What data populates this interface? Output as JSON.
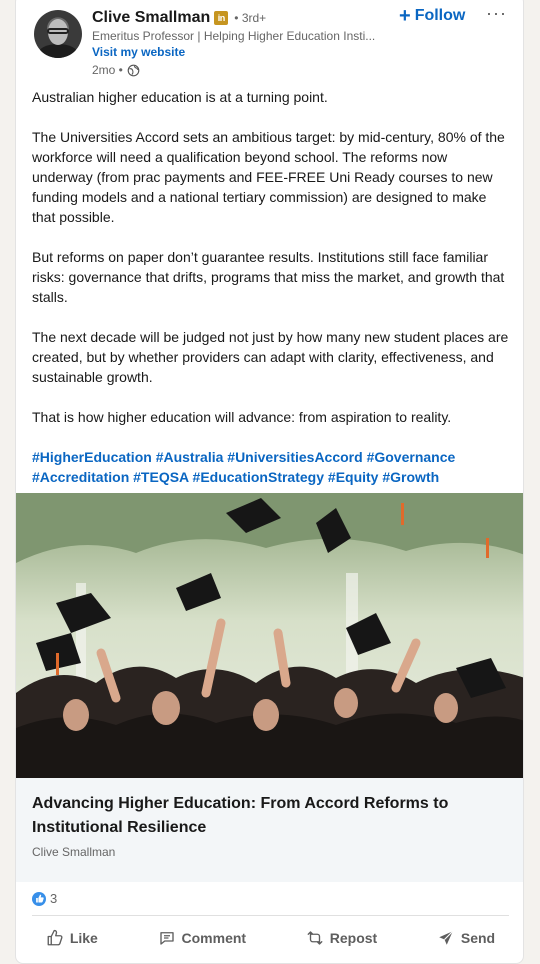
{
  "author": {
    "name": "Clive Smallman",
    "badge": "in",
    "degree": "• 3rd+",
    "headline": "Emeritus Professor | Helping Higher Education Insti...",
    "website_label": "Visit my website",
    "time": "2mo •"
  },
  "follow_label": "Follow",
  "more_label": "···",
  "post": {
    "paragraphs": [
      "Australian higher education is at a turning point.",
      "The Universities Accord sets an ambitious target: by mid-century, 80% of the workforce will need a qualification beyond school. The reforms now underway (from prac payments and FEE-FREE Uni Ready courses to new funding models and a national tertiary commission) are designed to make that possible.",
      "But reforms on paper don’t guarantee results. Institutions still face familiar risks: governance that drifts, programs that miss the market, and growth that stalls.",
      "The next decade will be judged not just by how many new student places are created, but by whether providers can adapt with clarity, effectiveness, and sustainable growth.",
      "That is how higher education will advance: from aspiration to reality."
    ],
    "hashtags": [
      "#HigherEducation",
      "#Australia",
      "#UniversitiesAccord",
      "#Governance",
      "#Accreditation",
      "#TEQSA",
      "#EducationStrategy",
      "#Equity",
      "#Growth"
    ]
  },
  "article": {
    "title": "Advancing Higher Education: From Accord Reforms to Institutional Resilience",
    "source": "Clive Smallman"
  },
  "social": {
    "reaction_count": "3",
    "actions": [
      "Like",
      "Comment",
      "Repost",
      "Send"
    ]
  },
  "colors": {
    "link_blue": "#0a66c2",
    "badge_gold": "#c69520",
    "reaction_blue": "#378fe9"
  },
  "icons": [
    "globe-icon",
    "plus-icon",
    "more-icon",
    "thumbs-up-icon",
    "comment-icon",
    "repost-icon",
    "send-icon"
  ]
}
